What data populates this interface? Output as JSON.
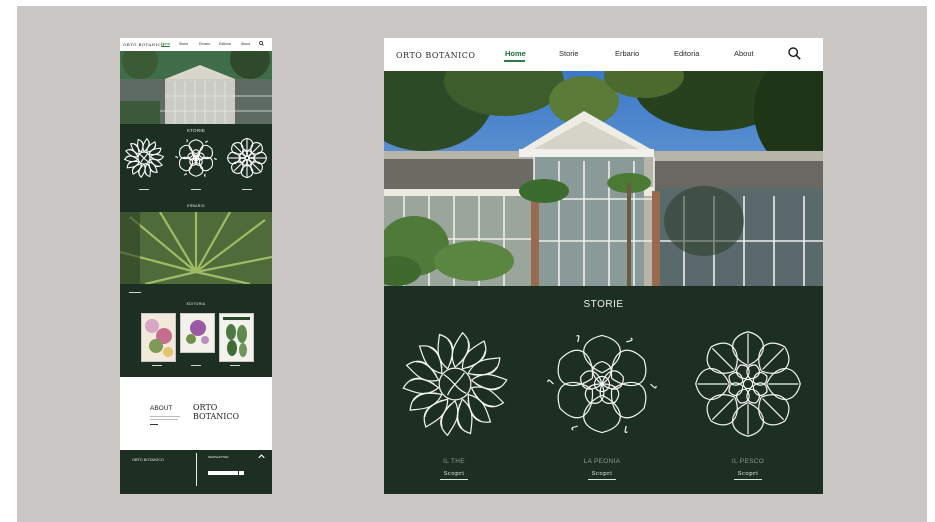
{
  "logo_text": "ORTO BOTANICO",
  "nav": {
    "items": [
      "Home",
      "Storie",
      "Erbario",
      "Editoria",
      "About"
    ],
    "active": "Home"
  },
  "sections": {
    "storie": "STORIE",
    "erbario": "ERBARIO",
    "editoria": "EDITORIA",
    "about": "ABOUT"
  },
  "stories": [
    {
      "title": "IL THE",
      "cta": "Scopri"
    },
    {
      "title": "LA PEONIA",
      "cta": "Scopri"
    },
    {
      "title": "IL PESCO",
      "cta": "Scopri"
    }
  ],
  "about_logo": {
    "line1": "ORTO",
    "line2": "BOTANICO"
  },
  "footer": {
    "newsletter": "NEWSLETTER"
  },
  "colors": {
    "dark_green": "#1d2f23",
    "accent": "#2f7d44",
    "background": "#cbc7c5"
  },
  "icons": [
    "search-icon",
    "chevron-up-icon",
    "arrow-right-icon"
  ]
}
